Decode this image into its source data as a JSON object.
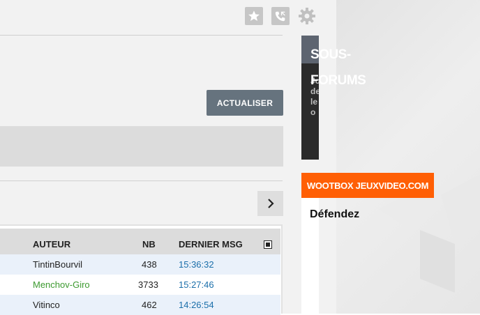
{
  "header": {
    "icons": [
      "star-icon",
      "phone-icon",
      "gear-icon"
    ]
  },
  "toolbar": {
    "refresh_label": "ACTUALISER"
  },
  "pagination": {
    "next_icon": "chevron-right-icon"
  },
  "table": {
    "columns": {
      "author": "AUTEUR",
      "nb": "NB",
      "last_msg": "DERNIER MSG"
    },
    "rows": [
      {
        "author": "TintinBourvil",
        "nb": "438",
        "time": "15:36:32"
      },
      {
        "author": "Menchov-Giro",
        "nb": "3733",
        "time": "15:27:46"
      },
      {
        "author": "Vitinco",
        "nb": "462",
        "time": "14:26:54"
      }
    ]
  },
  "sidebar": {
    "sous_forums_title": "SOUS-FORUMS",
    "sous_forums_text_fragment": "Jo de le je o",
    "wootbox_title": "WOOTBOX JEUXVIDEO.COM",
    "wootbox_text": "Défendez"
  },
  "colors": {
    "accent_orange": "#ff5f05",
    "button_gray": "#66737e",
    "link_blue": "#1b6faa",
    "author_green": "#3c9a2f"
  }
}
